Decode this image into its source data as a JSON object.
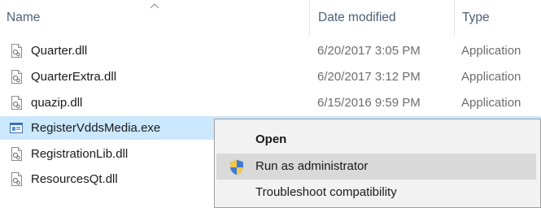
{
  "columns": {
    "name": "Name",
    "date_modified": "Date modified",
    "type": "Type"
  },
  "files": [
    {
      "name": "Quarter.dll",
      "date": "6/20/2017 3:05 PM",
      "type": "Application",
      "icon": "dll-file-icon"
    },
    {
      "name": "QuarterExtra.dll",
      "date": "6/20/2017 3:12 PM",
      "type": "Application",
      "icon": "dll-file-icon"
    },
    {
      "name": "quazip.dll",
      "date": "6/15/2016 9:59 PM",
      "type": "Application",
      "icon": "dll-file-icon"
    },
    {
      "name": "RegisterVddsMedia.exe",
      "date": "",
      "type": "",
      "icon": "exe-file-icon",
      "selected": true
    },
    {
      "name": "RegistrationLib.dll",
      "date": "",
      "type": "",
      "icon": "dll-file-icon"
    },
    {
      "name": "ResourcesQt.dll",
      "date": "",
      "type": "",
      "icon": "dll-file-icon"
    }
  ],
  "context_menu": {
    "items": [
      {
        "label": "Open",
        "bold": true
      },
      {
        "label": "Run as administrator",
        "icon": "uac-shield-icon",
        "hover": true
      },
      {
        "label": "Troubleshoot compatibility"
      }
    ]
  },
  "colors": {
    "selection": "#cce8ff",
    "menu_background": "#f2f2f2",
    "menu_hover": "#d9d9d9",
    "header_text": "#4c607a"
  }
}
